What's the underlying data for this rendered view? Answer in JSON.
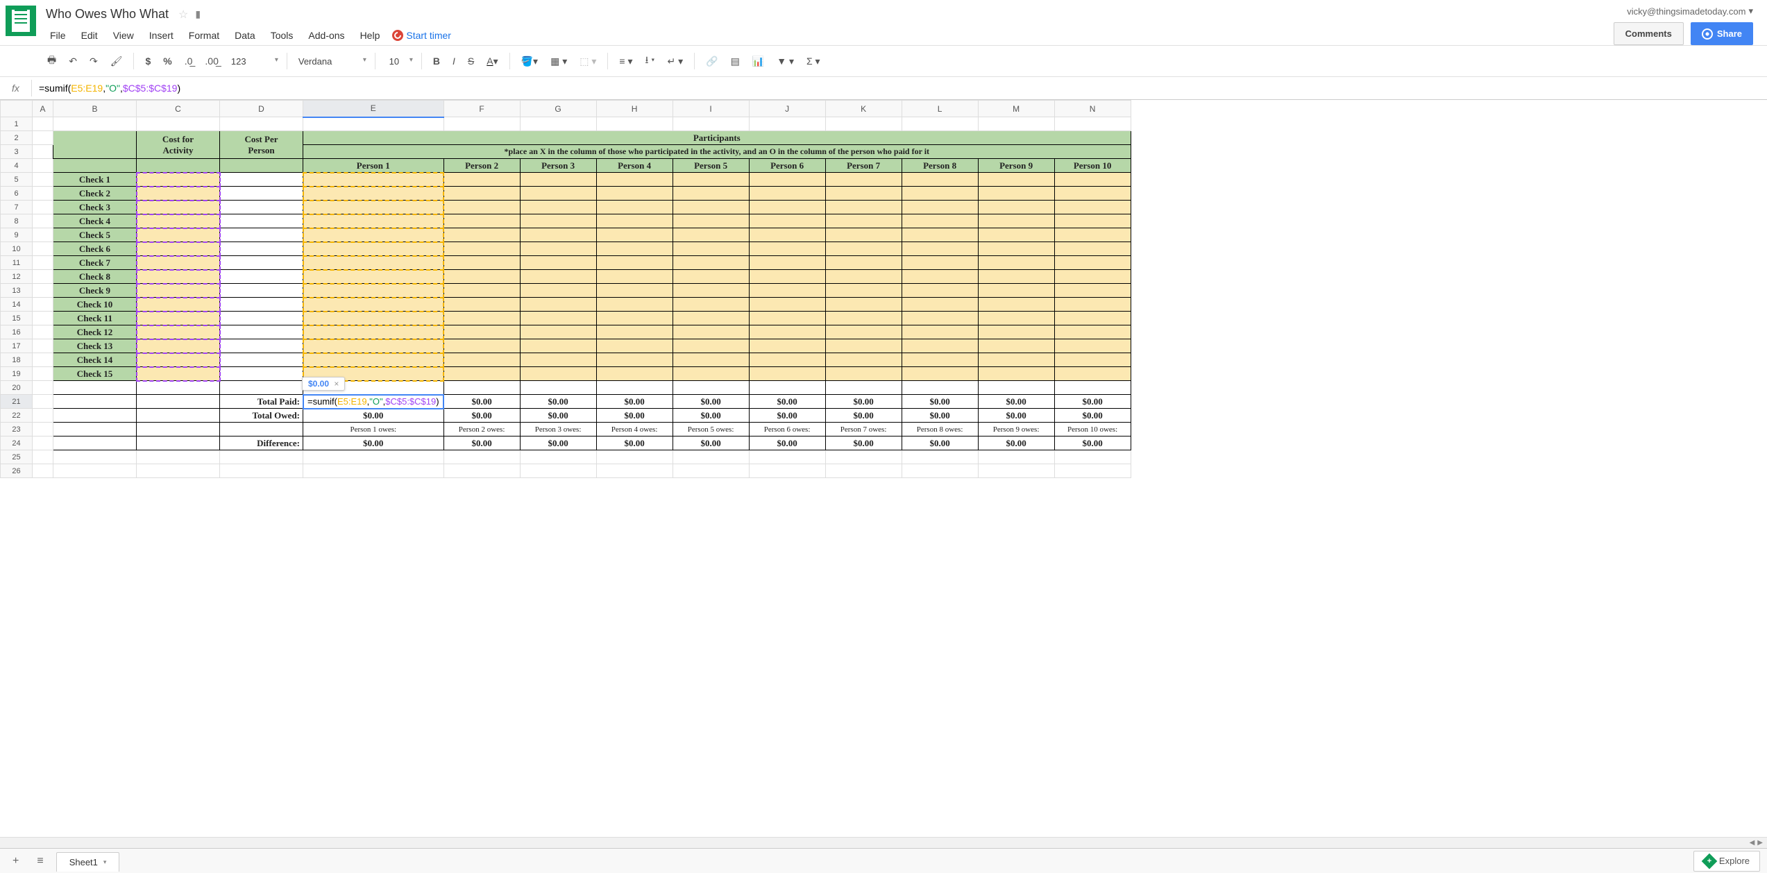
{
  "doc": {
    "title": "Who Owes Who What"
  },
  "user": {
    "email": "vicky@thingsimadetoday.com"
  },
  "header": {
    "comments": "Comments",
    "share": "Share"
  },
  "menu": [
    "File",
    "Edit",
    "View",
    "Insert",
    "Format",
    "Data",
    "Tools",
    "Add-ons",
    "Help"
  ],
  "timer": {
    "label": "Start timer"
  },
  "toolbar": {
    "font": "Verdana",
    "fontsize": "10"
  },
  "formula": {
    "prefix": "=sumif(",
    "r1": "E5:E19",
    "sep1": ",",
    "str": "\"O\"",
    "sep2": ",",
    "r2": "$C$5:$C$19",
    "suffix": ")"
  },
  "sheet": {
    "participants_header": "Participants",
    "instruction": "*place an X in the column of those who participated in the activity, and an O in the column of the person who paid for it",
    "cost_activity_l1": "Cost for",
    "cost_activity_l2": "Activity",
    "cost_person_l1": "Cost Per",
    "cost_person_l2": "Person",
    "persons": [
      "Person 1",
      "Person 2",
      "Person 3",
      "Person 4",
      "Person 5",
      "Person 6",
      "Person 7",
      "Person 8",
      "Person 9",
      "Person 10"
    ],
    "checks": [
      "Check 1",
      "Check 2",
      "Check 3",
      "Check 4",
      "Check 5",
      "Check 6",
      "Check 7",
      "Check 8",
      "Check 9",
      "Check 10",
      "Check 11",
      "Check 12",
      "Check 13",
      "Check 14",
      "Check 15"
    ],
    "total_paid": "Total Paid:",
    "total_owed": "Total Owed:",
    "difference": "Difference:",
    "owes": [
      "Person 1 owes:",
      "Person 2 owes:",
      "Person 3 owes:",
      "Person 4 owes:",
      "Person 5 owes:",
      "Person 6 owes:",
      "Person 7 owes:",
      "Person 8 owes:",
      "Person 9 owes:",
      "Person 10 owes:"
    ],
    "zero": "$0.00",
    "hint": "$0.00"
  },
  "columns": [
    "A",
    "B",
    "C",
    "D",
    "E",
    "F",
    "G",
    "H",
    "I",
    "J",
    "K",
    "L",
    "M",
    "N"
  ],
  "tabs": {
    "sheet1": "Sheet1",
    "explore": "Explore"
  }
}
